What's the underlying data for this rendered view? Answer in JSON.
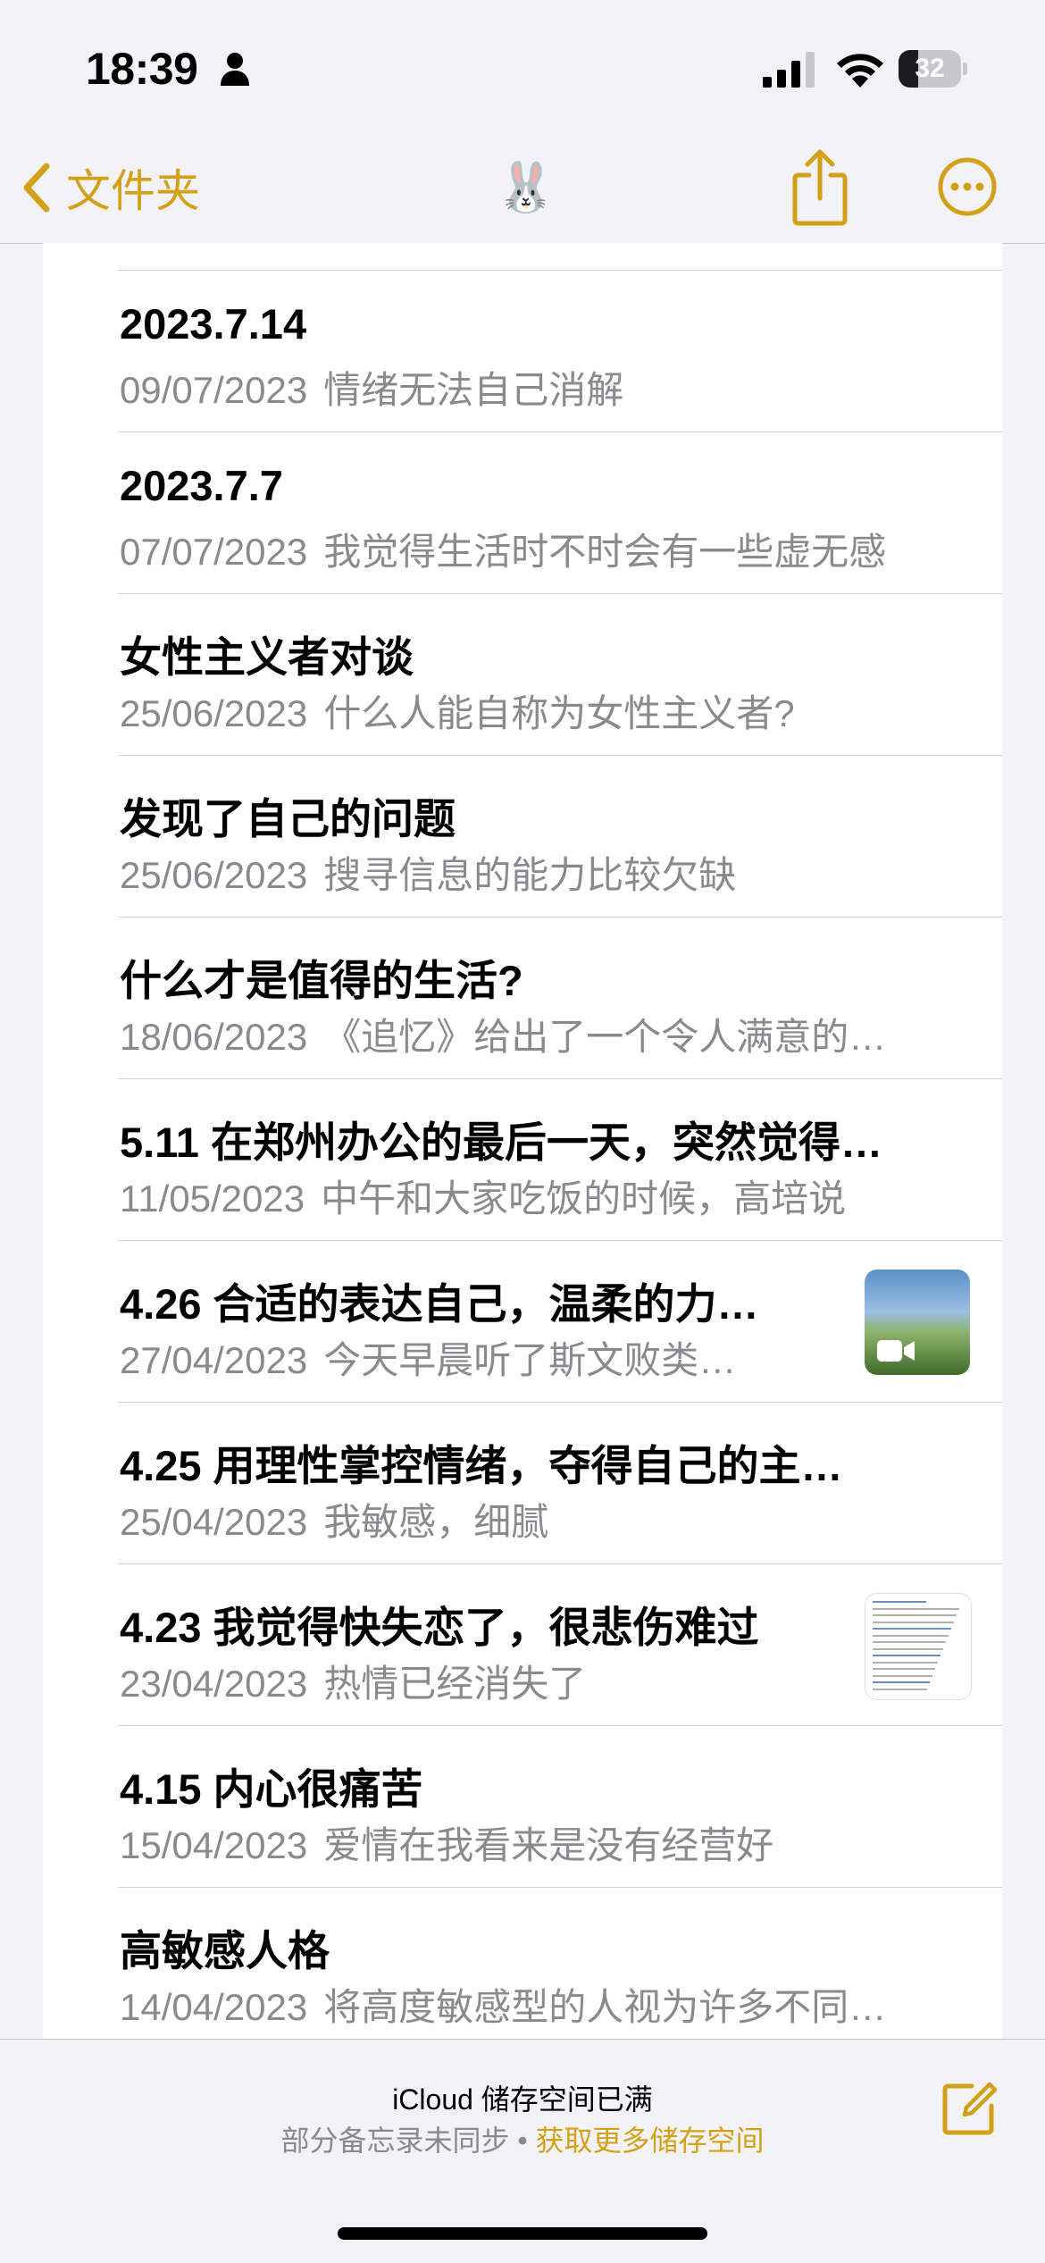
{
  "status_bar": {
    "time": "18:39",
    "battery_level": "32",
    "icons": [
      "person-icon",
      "cellular-signal-icon",
      "wifi-icon",
      "battery-icon"
    ]
  },
  "nav": {
    "back_label": "文件夹",
    "title_emoji": "🐰",
    "accent_color": "#d4a017",
    "icons": [
      "chevron-left-icon",
      "share-icon",
      "more-icon"
    ]
  },
  "notes": [
    {
      "title": "2023.7.14",
      "date": "09/07/2023",
      "preview": "情绪无法自己消解"
    },
    {
      "title": "2023.7.7",
      "date": "07/07/2023",
      "preview": "我觉得生活时不时会有一些虚无感"
    },
    {
      "title": "女性主义者对谈",
      "date": "25/06/2023",
      "preview": "什么人能自称为女性主义者?"
    },
    {
      "title": "发现了自己的问题",
      "date": "25/06/2023",
      "preview": "搜寻信息的能力比较欠缺"
    },
    {
      "title": "什么才是值得的生活?",
      "date": "18/06/2023",
      "preview": "《追忆》给出了一个令人满意的…"
    },
    {
      "title": "5.11 在郑州办公的最后一天，突然觉得…",
      "date": "11/05/2023",
      "preview": "中午和大家吃饭的时候，高培说"
    },
    {
      "title": "4.26 合适的表达自己，温柔的力…",
      "date": "27/04/2023",
      "preview": "今天早晨听了斯文败类…",
      "thumbnail": "video-thumbnail"
    },
    {
      "title": "4.25  用理性掌控情绪，夺得自己的主…",
      "date": "25/04/2023",
      "preview": "我敏感，细腻"
    },
    {
      "title": "4.23 我觉得快失恋了，很悲伤难过",
      "date": "23/04/2023",
      "preview": "热情已经消失了",
      "thumbnail": "document-thumbnail"
    },
    {
      "title": "4.15 内心很痛苦",
      "date": "15/04/2023",
      "preview": "爱情在我看来是没有经营好"
    },
    {
      "title": "高敏感人格",
      "date": "14/04/2023",
      "preview": "将高度敏感型的人视为许多不同…"
    }
  ],
  "footer": {
    "title": "iCloud 储存空间已满",
    "subtitle": "部分备忘录未同步 • ",
    "link": "获取更多储存空间",
    "icons": [
      "compose-icon"
    ]
  }
}
